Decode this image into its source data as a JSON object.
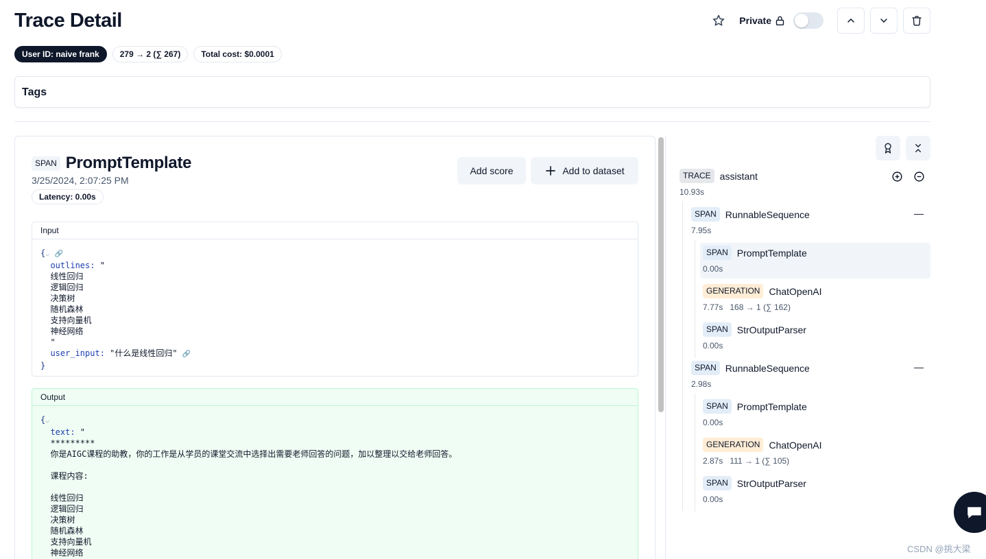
{
  "header": {
    "title": "Trace Detail",
    "private_label": "Private"
  },
  "badges": {
    "user": "User ID: naive frank",
    "tokens": "279 → 2 (∑ 267)",
    "cost": "Total cost: $0.0001"
  },
  "tags": {
    "title": "Tags"
  },
  "detail": {
    "type": "SPAN",
    "name": "PromptTemplate",
    "timestamp": "3/25/2024, 2:07:25 PM",
    "latency": "Latency: 0.00s",
    "add_score": "Add score",
    "add_dataset": "Add to dataset",
    "input": {
      "title": "Input",
      "open": "{",
      "outlines_key": "outlines:",
      "outlines_open": " \"",
      "lines": [
        "线性回归",
        "逻辑回归",
        "决策树",
        "随机森林",
        "支持向量机",
        "神经网络"
      ],
      "outlines_close": "\"",
      "user_input_key": "user_input:",
      "user_input_val": " \"什么是线性回归\"",
      "close": "}"
    },
    "output": {
      "title": "Output",
      "open": "{",
      "text_key": "text:",
      "text_open": " \"",
      "lines": [
        "*********",
        "你是AIGC课程的助教，你的工作是从学员的课堂交流中选择出需要老师回答的问题，加以整理以交给老师回答。",
        "",
        "课程内容:",
        "",
        "线性回归",
        "逻辑回归",
        "决策树",
        "随机森林",
        "支持向量机",
        "神经网络"
      ]
    }
  },
  "tree": {
    "root": {
      "type": "TRACE",
      "name": "assistant",
      "meta": "10.93s"
    },
    "groups": [
      {
        "type": "SPAN",
        "name": "RunnableSequence",
        "meta": "7.95s",
        "children": [
          {
            "type": "SPAN",
            "name": "PromptTemplate",
            "meta": "0.00s",
            "selected": true
          },
          {
            "type": "GENERATION",
            "name": "ChatOpenAI",
            "meta": "7.77s   168 → 1 (∑ 162)"
          },
          {
            "type": "SPAN",
            "name": "StrOutputParser",
            "meta": "0.00s"
          }
        ]
      },
      {
        "type": "SPAN",
        "name": "RunnableSequence",
        "meta": "2.98s",
        "children": [
          {
            "type": "SPAN",
            "name": "PromptTemplate",
            "meta": "0.00s"
          },
          {
            "type": "GENERATION",
            "name": "ChatOpenAI",
            "meta": "2.87s   111 → 1 (∑ 105)"
          },
          {
            "type": "SPAN",
            "name": "StrOutputParser",
            "meta": "0.00s"
          }
        ]
      }
    ]
  },
  "watermark": "CSDN @挑大梁",
  "colors": {
    "accent_dark": "#0f172a",
    "output_bg": "#f0fdf4",
    "generation_tag": "#ffedd5",
    "span_tag": "#e2edf8"
  },
  "icons": [
    "star-icon",
    "lock-icon",
    "chevron-up-icon",
    "chevron-down-icon",
    "trash-icon",
    "plus-icon",
    "award-icon",
    "collapse-all-icon",
    "expand-plus-icon",
    "collapse-minus-icon",
    "chat-icon"
  ]
}
